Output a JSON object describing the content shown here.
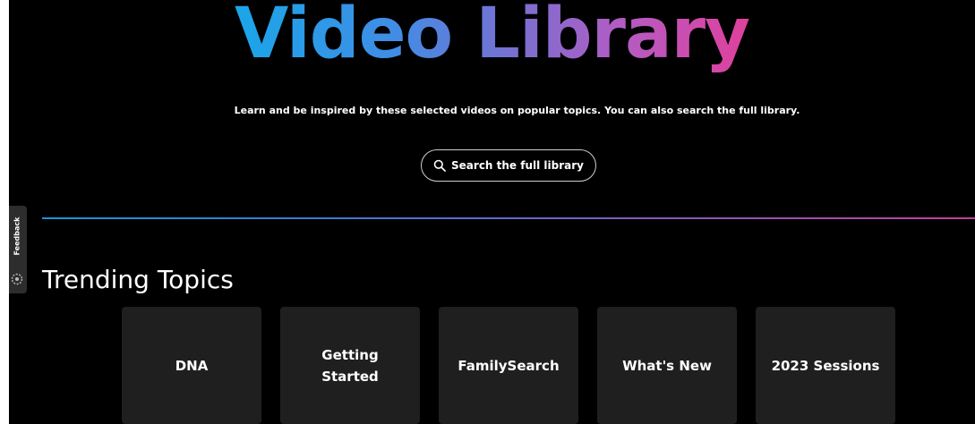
{
  "hero": {
    "title": "Video Library",
    "subtitle": "Learn and be inspired by these selected videos on popular topics. You can also search the full library."
  },
  "search": {
    "label": "Search the full library",
    "icon": "search-icon"
  },
  "feedback": {
    "label": "Feedback",
    "icon": "feedback-icon"
  },
  "trending": {
    "title": "Trending Topics",
    "topics": [
      {
        "label": "DNA"
      },
      {
        "label": "Getting Started"
      },
      {
        "label": "FamilySearch"
      },
      {
        "label": "What's New"
      },
      {
        "label": "2023 Sessions"
      }
    ]
  },
  "colors": {
    "background": "#000000",
    "card": "#1f1f1f",
    "gradient_start": "#1aa6e8",
    "gradient_mid": "#7a6fd0",
    "gradient_end": "#e0409c"
  }
}
